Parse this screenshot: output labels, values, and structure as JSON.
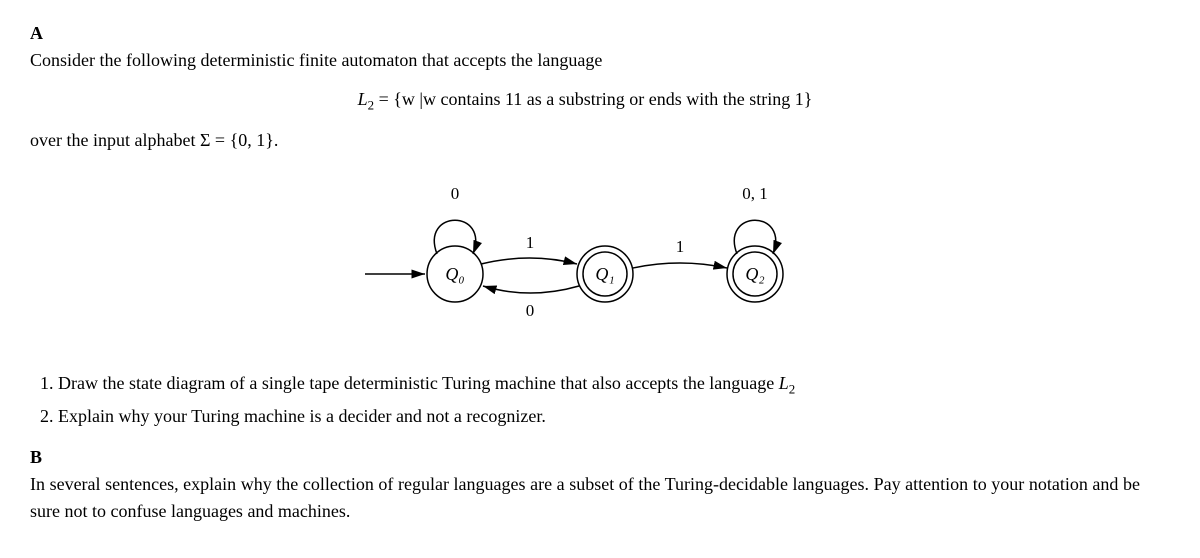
{
  "partA": {
    "label": "A",
    "intro": "Consider the following deterministic finite automaton that accepts the language",
    "languageDef_pre": "L",
    "languageDef_sub": "2",
    "languageDef_mid": " = {w |w contains 11 as a substring or ends with the string 1}",
    "alphabet_pre": "over the input alphabet Σ = {0, 1}.",
    "diagram": {
      "q0": "Q₀",
      "q1": "Q₁",
      "q2": "Q₂",
      "loop0": "0",
      "loop2": "0, 1",
      "t01": "1",
      "t10": "0",
      "t12": "1"
    },
    "item1_pre": "Draw the state diagram of a single tape deterministic Turing machine that also accepts the language ",
    "item1_L": "L",
    "item1_sub": "2",
    "item2": "Explain why your Turing machine is a decider and not a recognizer."
  },
  "partB": {
    "label": "B",
    "text": "In several sentences, explain why the collection of regular languages are a subset of the Turing-decidable languages. Pay attention to your notation and be sure not to confuse languages and machines."
  }
}
